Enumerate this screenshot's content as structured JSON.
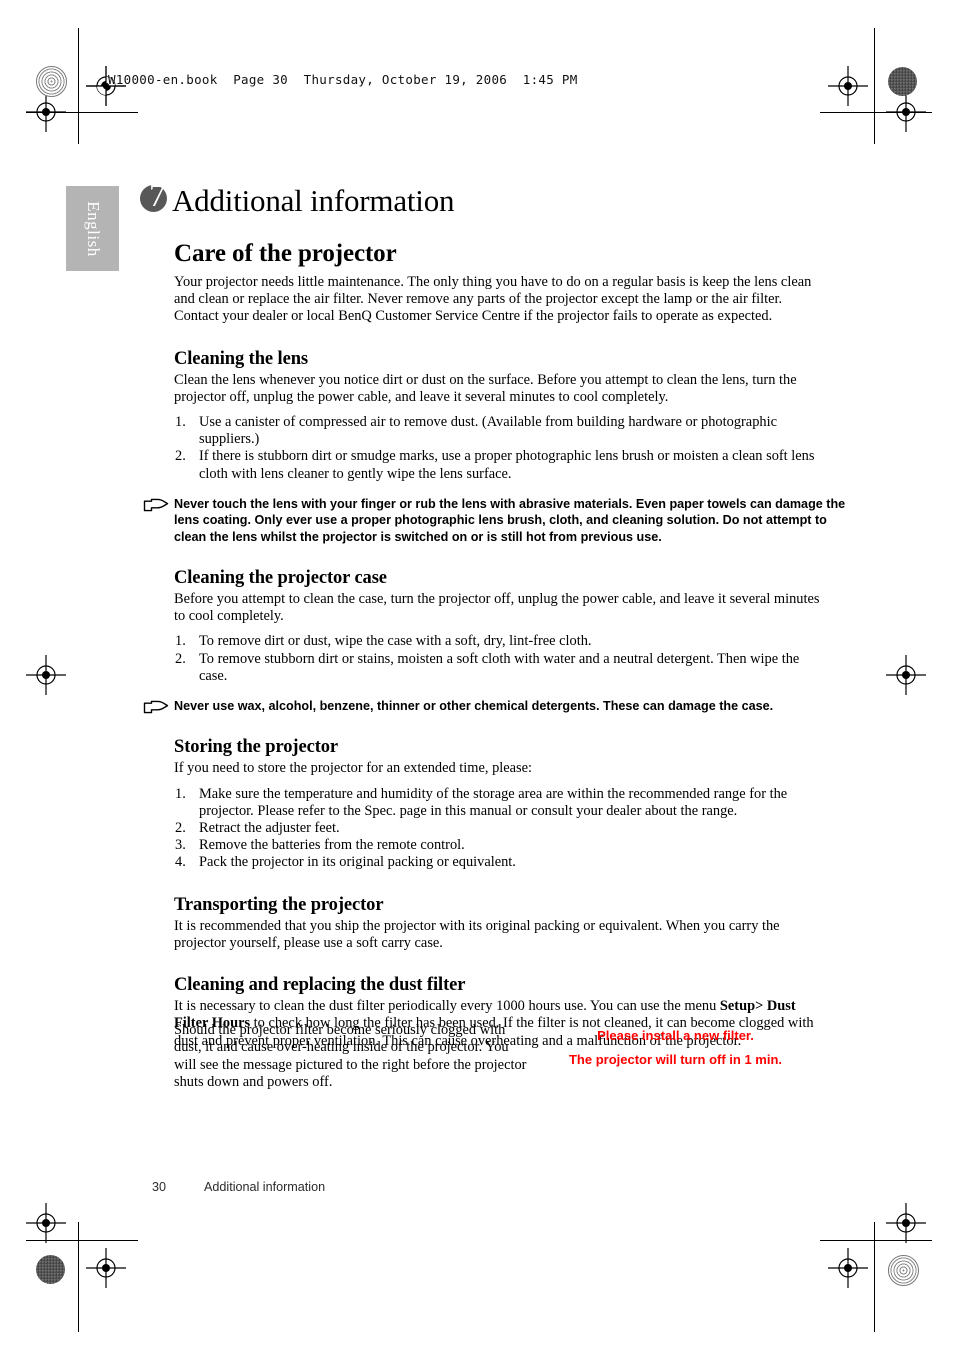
{
  "file_header": "W10000-en.book  Page 30  Thursday, October 19, 2006  1:45 PM",
  "side_tab": {
    "label": "English"
  },
  "chapter": {
    "number": "7",
    "title": "Additional information"
  },
  "sections": {
    "care_heading": "Care of the projector",
    "care_intro": "Your projector needs little maintenance. The only thing you have to do on a regular basis is keep the lens clean and clean or replace the air filter. Never remove any parts of the projector except the lamp or the air filter. Contact your dealer or local BenQ Customer Service Centre if the projector fails to operate as expected.",
    "lens_heading": "Cleaning the lens",
    "lens_intro": "Clean the lens whenever you notice dirt or dust on the surface. Before you attempt to clean the lens, turn the projector off, unplug the power cable, and leave it several minutes to cool completely.",
    "lens_steps": [
      {
        "num": "1.",
        "text": "Use a canister of compressed air to remove dust. (Available from building hardware or photographic suppliers.)"
      },
      {
        "num": "2.",
        "text": "If there is stubborn dirt or smudge marks, use a proper photographic lens brush or moisten a clean soft lens cloth with lens cleaner to gently wipe the lens surface."
      }
    ],
    "lens_note": "Never touch the lens with your finger or rub the lens with abrasive materials. Even paper towels can damage the lens coating. Only ever use a proper photographic lens brush, cloth, and cleaning solution. Do not attempt to clean the lens whilst the projector is switched on or is still hot from previous use.",
    "case_heading": "Cleaning the projector case",
    "case_intro": "Before you attempt to clean the case, turn the projector off, unplug the power cable, and leave it several minutes to cool completely.",
    "case_steps": [
      {
        "num": "1.",
        "text": "To remove dirt or dust, wipe the case with a soft, dry, lint-free cloth."
      },
      {
        "num": "2.",
        "text": "To remove stubborn dirt or stains, moisten a soft cloth with water and a neutral detergent. Then wipe the case."
      }
    ],
    "case_note": "Never use wax, alcohol, benzene, thinner or other chemical detergents. These can damage the case.",
    "storing_heading": "Storing the projector",
    "storing_intro": "If you need to store the projector for an extended time, please:",
    "storing_steps": [
      {
        "num": "1.",
        "text": "Make sure the temperature and humidity of the storage area are within the recommended range for the projector. Please refer to the Spec. page in this manual or consult your dealer about the range."
      },
      {
        "num": "2.",
        "text": "Retract the adjuster feet."
      },
      {
        "num": "3.",
        "text": "Remove the batteries from the remote control."
      },
      {
        "num": "4.",
        "text": "Pack the projector in its original packing or equivalent."
      }
    ],
    "transport_heading": "Transporting the projector",
    "transport_body": "It is recommended that you ship the projector with its original packing or equivalent. When you carry the projector yourself, please use a soft carry case.",
    "filter_heading": "Cleaning and replacing the dust filter",
    "filter_body_part1": "It is necessary to clean the dust filter periodically every 1000 hours use. You can use the menu ",
    "filter_body_menu": "Setup> Dust Filter Hours",
    "filter_body_part2": " to check how long the filter has been used. If the filter is not cleaned, it can become clogged with dust and prevent proper ventilation. This can cause overheating and a malfunction of the projector.",
    "clogged_body": "Should the projector filter become seriously clogged with dust, it and cause over-heating inside of the projector. You will see the message pictured to the right before the projector shuts down and powers off."
  },
  "osd_message": {
    "line1": "Please install a new filter.",
    "line2": "The projector will turn off in 1 min.",
    "color": "#ff0000"
  },
  "footer": {
    "page_number": "30",
    "section_label": "Additional information"
  },
  "icons": {
    "note": "pointing-hand-icon"
  },
  "colors": {
    "tab_gray": "#b4b4b4",
    "badge_gray": "#585858",
    "warning_red": "#ff0000"
  }
}
